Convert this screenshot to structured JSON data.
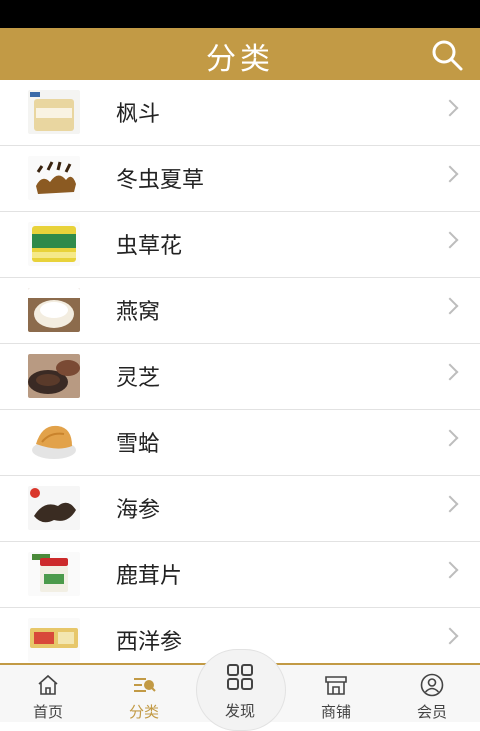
{
  "header": {
    "title": "分类",
    "search_icon": "search-icon"
  },
  "categories": [
    {
      "label": "枫斗",
      "thumb": "product-box-image"
    },
    {
      "label": "冬虫夏草",
      "thumb": "cordyceps-image"
    },
    {
      "label": "虫草花",
      "thumb": "cordyceps-flower-can-image"
    },
    {
      "label": "燕窝",
      "thumb": "birds-nest-image"
    },
    {
      "label": "灵芝",
      "thumb": "reishi-image"
    },
    {
      "label": "雪蛤",
      "thumb": "snow-frog-image"
    },
    {
      "label": "海参",
      "thumb": "sea-cucumber-image"
    },
    {
      "label": "鹿茸片",
      "thumb": "deer-antler-jar-image"
    },
    {
      "label": "西洋参",
      "thumb": "ginseng-box-image"
    }
  ],
  "tabs": [
    {
      "label": "首页",
      "icon": "home-icon"
    },
    {
      "label": "分类",
      "icon": "category-icon",
      "active": true
    },
    {
      "label": "发现",
      "icon": "grid-icon"
    },
    {
      "label": "商铺",
      "icon": "shop-icon"
    },
    {
      "label": "会员",
      "icon": "user-icon"
    }
  ],
  "colors": {
    "accent": "#c29a45",
    "statusbar": "#000000"
  }
}
